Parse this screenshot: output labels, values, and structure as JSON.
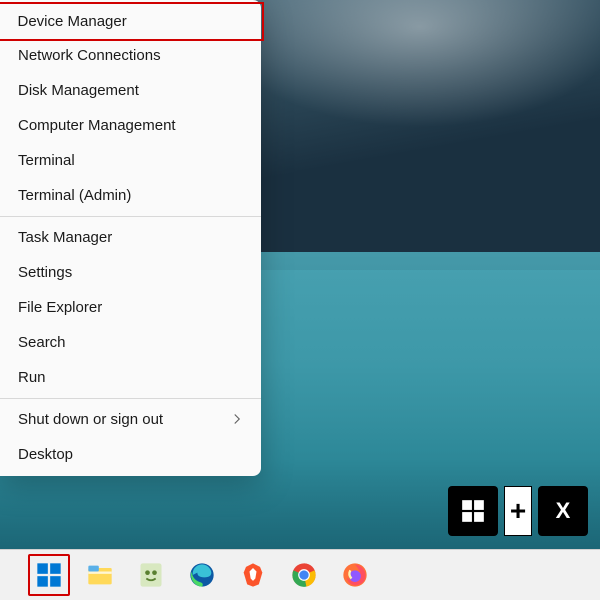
{
  "menu": {
    "group1": [
      {
        "label": "Device Manager",
        "highlight": true
      },
      {
        "label": "Network Connections"
      },
      {
        "label": "Disk Management"
      },
      {
        "label": "Computer Management"
      },
      {
        "label": "Terminal"
      },
      {
        "label": "Terminal (Admin)"
      }
    ],
    "group2": [
      {
        "label": "Task Manager"
      },
      {
        "label": "Settings"
      },
      {
        "label": "File Explorer"
      },
      {
        "label": "Search"
      },
      {
        "label": "Run"
      }
    ],
    "group3": [
      {
        "label": "Shut down or sign out",
        "submenu": true
      },
      {
        "label": "Desktop"
      }
    ]
  },
  "shortcut": {
    "key1_icon": "windows",
    "plus": "+",
    "key2": "X"
  },
  "taskbar": {
    "items": [
      {
        "name": "start",
        "highlight": true
      },
      {
        "name": "file-explorer"
      },
      {
        "name": "notepad-plus"
      },
      {
        "name": "edge"
      },
      {
        "name": "brave"
      },
      {
        "name": "chrome"
      },
      {
        "name": "firefox"
      }
    ]
  }
}
